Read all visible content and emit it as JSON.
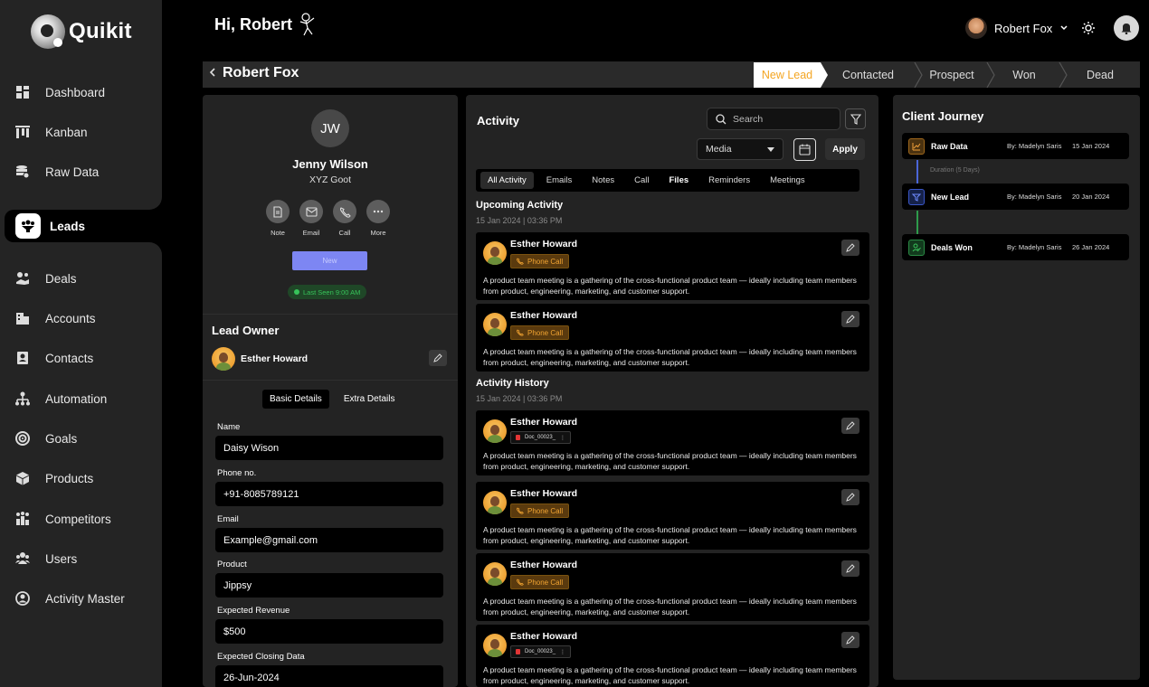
{
  "brand": {
    "name": "Quikit"
  },
  "header": {
    "greeting": "Hi, Robert",
    "user_name": "Robert Fox"
  },
  "sidebar": {
    "items": [
      {
        "label": "Dashboard",
        "icon": "dashboard-icon"
      },
      {
        "label": "Kanban",
        "icon": "kanban-icon"
      },
      {
        "label": "Raw Data",
        "icon": "raw-data-icon"
      },
      {
        "label": "Leads",
        "icon": "leads-icon",
        "active": true
      },
      {
        "label": "Deals",
        "icon": "deals-icon"
      },
      {
        "label": "Accounts",
        "icon": "accounts-icon"
      },
      {
        "label": "Contacts",
        "icon": "contacts-icon"
      },
      {
        "label": "Automation",
        "icon": "automation-icon"
      },
      {
        "label": "Goals",
        "icon": "goals-icon"
      },
      {
        "label": "Products",
        "icon": "products-icon"
      },
      {
        "label": "Competitors",
        "icon": "competitors-icon"
      },
      {
        "label": "Users",
        "icon": "users-icon"
      },
      {
        "label": "Activity Master",
        "icon": "activity-master-icon"
      }
    ]
  },
  "lead": {
    "name": "Robert Fox"
  },
  "stages": [
    "New Lead",
    "Contacted",
    "Prospect",
    "Won",
    "Dead"
  ],
  "contact": {
    "initials": "JW",
    "name": "Jenny Wilson",
    "company": "XYZ Goot",
    "actions": [
      "Note",
      "Email",
      "Call",
      "More"
    ],
    "status_button": "New",
    "last_seen": "Last Seen 9:00 AM"
  },
  "owner": {
    "title": "Lead Owner",
    "name": "Esther Howard"
  },
  "detail_tabs": [
    "Basic Details",
    "Extra Details"
  ],
  "fields": [
    {
      "label": "Name",
      "value": "Daisy Wison"
    },
    {
      "label": "Phone no.",
      "value": "+91-8085789121"
    },
    {
      "label": "Email",
      "value": "Example@gmail.com"
    },
    {
      "label": "Product",
      "value": "Jippsy"
    },
    {
      "label": "Expected Revenue",
      "value": "$500"
    },
    {
      "label": "Expected Closing Data",
      "value": "26-Jun-2024"
    }
  ],
  "activity": {
    "title": "Activity",
    "search_placeholder": "Search",
    "media_select": "Media",
    "apply_label": "Apply",
    "tabs": [
      "All Activity",
      "Emails",
      "Notes",
      "Call",
      "Files",
      "Reminders",
      "Meetings"
    ],
    "upcoming_title": "Upcoming Activity",
    "upcoming_date": "15 Jan 2024 | 03:36 PM",
    "history_title": "Activity History",
    "history_date": "15 Jan 2024 | 03:36 PM",
    "cards": [
      {
        "name": "Esther Howard",
        "tag": "Phone Call",
        "text": "A product team meeting is a gathering of the cross-functional product team — ideally including team members from product, engineering, marketing, and customer support."
      },
      {
        "name": "Esther Howard",
        "tag": "Phone Call",
        "text": "A product team meeting is a gathering of the cross-functional product team — ideally including team members from product, engineering, marketing, and customer support."
      },
      {
        "name": "Esther Howard",
        "tag": "Doc_00023_",
        "text": "A product team meeting is a gathering of the cross-functional product team — ideally including team members from product, engineering, marketing, and customer support."
      },
      {
        "name": "Esther Howard",
        "tag": "Phone Call",
        "text": "A product team meeting is a gathering of the cross-functional product team — ideally including team members from product, engineering, marketing, and customer support."
      },
      {
        "name": "Esther Howard",
        "tag": "Phone Call",
        "text": "A product team meeting is a gathering of the cross-functional product team — ideally including team members from product, engineering, marketing, and customer support."
      },
      {
        "name": "Esther Howard",
        "tag": "Doc_00023_",
        "text": "A product team meeting is a gathering of the cross-functional product team — ideally including team members from product, engineering, marketing, and customer support."
      }
    ]
  },
  "journey": {
    "title": "Client Journey",
    "duration": "Duration (5 Days)",
    "steps": [
      {
        "title": "Raw Data",
        "by": "By: Madelyn Saris",
        "date": "15 Jan 2024",
        "color": "#f0a03a"
      },
      {
        "title": "New Lead",
        "by": "By: Madelyn Saris",
        "date": "20 Jan 2024",
        "color": "#5b7cf6"
      },
      {
        "title": "Deals Won",
        "by": "By: Madelyn Saris",
        "date": "26 Jan 2024",
        "color": "#3bbf5a"
      }
    ]
  }
}
